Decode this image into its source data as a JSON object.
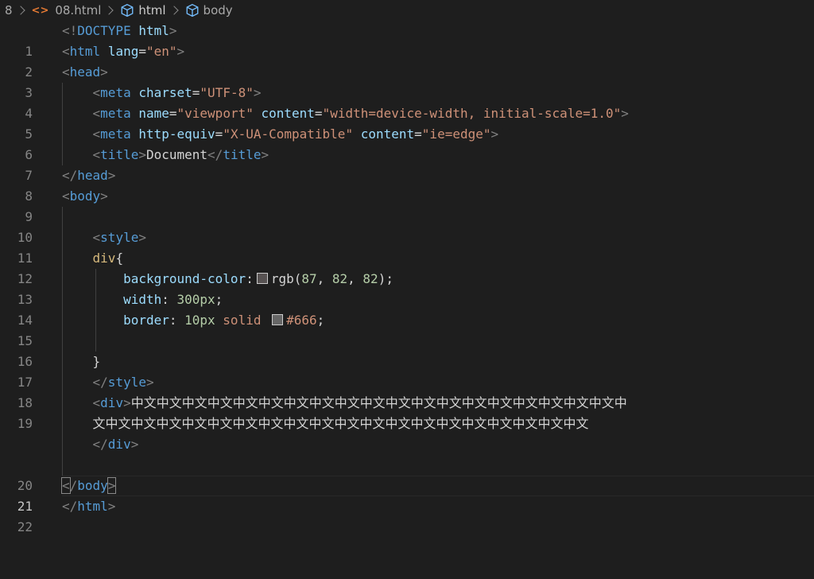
{
  "breadcrumb": {
    "prefix": "8",
    "file": "08.html",
    "crumb_html": "html",
    "crumb_body": "body"
  },
  "colors": {
    "background": "#1e1e1e",
    "tag": "#569cd6",
    "attribute": "#9cdcfe",
    "string": "#ce9178",
    "selector": "#d7ba7d",
    "number": "#b5cea8",
    "bracket": "#808080",
    "swatch_rgb": "#575252",
    "swatch_666": "#666666"
  },
  "lines": [
    {
      "n": "1",
      "code": "<!DOCTYPE html>"
    },
    {
      "n": "2",
      "code": "<html lang=\"en\">"
    },
    {
      "n": "3",
      "code": "<head>"
    },
    {
      "n": "4",
      "code": "    <meta charset=\"UTF-8\">"
    },
    {
      "n": "5",
      "code": "    <meta name=\"viewport\" content=\"width=device-width, initial-scale=1.0\">"
    },
    {
      "n": "6",
      "code": "    <meta http-equiv=\"X-UA-Compatible\" content=\"ie=edge\">"
    },
    {
      "n": "7",
      "code": "    <title>Document</title>"
    },
    {
      "n": "8",
      "code": "</head>"
    },
    {
      "n": "9",
      "code": "<body>"
    },
    {
      "n": "10",
      "code": ""
    },
    {
      "n": "11",
      "code": "    <style>"
    },
    {
      "n": "12",
      "code": "    div{"
    },
    {
      "n": "13",
      "code": "        background-color: rgb(87, 82, 82);"
    },
    {
      "n": "14",
      "code": "        width: 300px;"
    },
    {
      "n": "15",
      "code": "        border: 10px solid #666;"
    },
    {
      "n": "16",
      "code": ""
    },
    {
      "n": "17",
      "code": "    }"
    },
    {
      "n": "18",
      "code": "    </style>"
    },
    {
      "n": "19",
      "code": "    <div>中文中文中文中文中文中文中文中文中文中文中文中文中文中文中文中文中文中文中文中文中文中文中文中文中文中文中文中文中文中文中文中文中文中文中文</div>"
    },
    {
      "n": "20",
      "code": ""
    },
    {
      "n": "21",
      "code": "</body>"
    },
    {
      "n": "22",
      "code": "</html>"
    }
  ],
  "wrap19": {
    "row1": "中文中文中文中文中文中文中文中文中文中文中文中文中文中文中文中文中文中文中文中",
    "row2": "文中文中文中文中文中文中文中文中文中文中文中文中文中文中文中文中文中文中文中文"
  },
  "active_line": "21"
}
